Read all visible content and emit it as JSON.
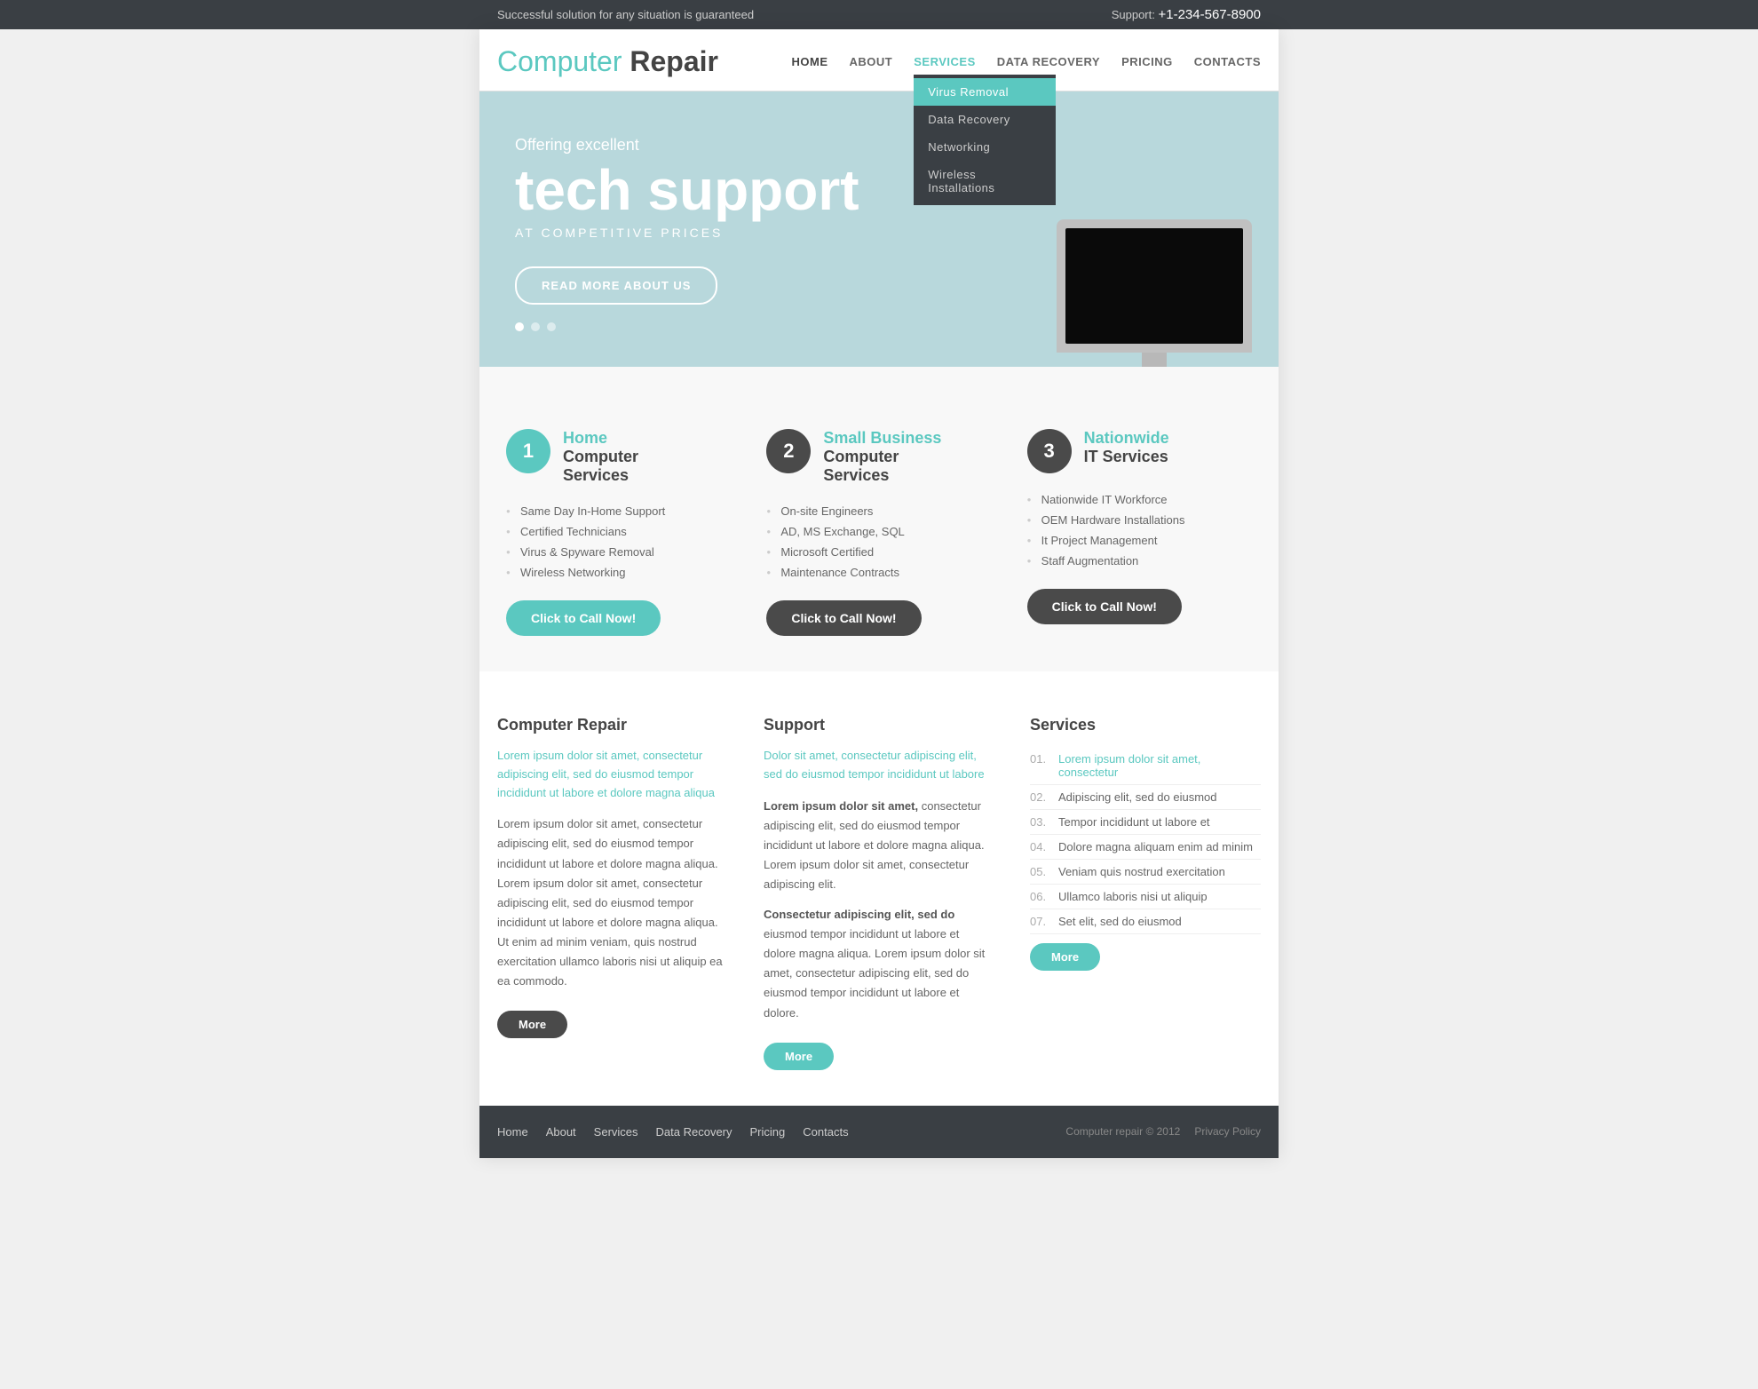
{
  "topbar": {
    "tagline": "Successful solution for any situation is guaranteed",
    "support_label": "Support:",
    "phone": "+1-234-567-8900"
  },
  "header": {
    "logo_teal": "Computer",
    "logo_dark": "Repair",
    "nav": {
      "items": [
        {
          "label": "HOME",
          "active": true
        },
        {
          "label": "ABOUT",
          "active": false
        },
        {
          "label": "SERVICES",
          "active": false,
          "has_dropdown": true
        },
        {
          "label": "DATA RECOVERY",
          "active": false
        },
        {
          "label": "PRICING",
          "active": false
        },
        {
          "label": "CONTACTS",
          "active": false
        }
      ],
      "dropdown": [
        {
          "label": "Virus Removal",
          "highlighted": true
        },
        {
          "label": "Data Recovery",
          "highlighted": false
        },
        {
          "label": "Networking",
          "highlighted": false
        },
        {
          "label": "Wireless Installations",
          "highlighted": false
        }
      ]
    }
  },
  "hero": {
    "sub": "Offering excellent",
    "title": "tech support",
    "subtitle": "AT COMPETITIVE PRICES",
    "button": "READ MORE ABOUT US"
  },
  "services": [
    {
      "num": "1",
      "color": "teal",
      "title_line1": "Home",
      "title_line2": "Computer Services",
      "items": [
        "Same Day In-Home Support",
        "Certified Technicians",
        "Virus & Spyware Removal",
        "Wireless Networking"
      ],
      "button": "Click to Call Now!"
    },
    {
      "num": "2",
      "color": "dark",
      "title_line1": "Small Business",
      "title_line2": "Computer Services",
      "items": [
        "On-site Engineers",
        "AD, MS Exchange, SQL",
        "Microsoft Certified",
        "Maintenance Contracts"
      ],
      "button": "Click to Call Now!"
    },
    {
      "num": "3",
      "color": "dark",
      "title_line1": "Nationwide",
      "title_line2": "IT Services",
      "items": [
        "Nationwide IT Workforce",
        "OEM Hardware Installations",
        "It Project Management",
        "Staff Augmentation"
      ],
      "button": "Click to Call Now!"
    }
  ],
  "content": {
    "col1": {
      "title": "Computer Repair",
      "teal_text": "Lorem ipsum dolor sit amet, consectetur adipiscing elit, sed do eiusmod tempor incididunt ut labore et dolore magna aliqua",
      "body": "Lorem ipsum dolor sit amet, consectetur adipiscing elit, sed do eiusmod tempor incididunt ut labore et dolore magna aliqua.  Lorem ipsum dolor sit amet, consectetur adipiscing elit, sed do eiusmod tempor incididunt ut labore et dolore magna aliqua.  Ut enim ad minim veniam, quis nostrud exercitation ullamco laboris nisi ut aliquip ea ea commodo.",
      "more": "More",
      "btn_style": "dark"
    },
    "col2": {
      "title": "Support",
      "teal_text": "Dolor sit amet, consectetur adipiscing elit, sed do eiusmod tempor incididunt ut labore",
      "body1_bold": "Lorem ipsum dolor sit amet,",
      "body1": " consectetur adipiscing elit, sed do eiusmod tempor incididunt ut labore et dolore magna aliqua.  Lorem ipsum dolor sit amet, consectetur adipiscing elit.",
      "body2_bold": "Consectetur adipiscing elit, sed do",
      "body2": " eiusmod tempor incididunt ut labore et dolore magna aliqua.  Lorem ipsum dolor sit amet, consectetur adipiscing elit, sed do eiusmod tempor incididunt ut labore et dolore.",
      "more": "More",
      "btn_style": "teal"
    },
    "col3": {
      "title": "Services",
      "more": "More",
      "btn_style": "teal",
      "items": [
        {
          "num": "01.",
          "text": "Lorem ipsum dolor sit amet, consectetur",
          "active": true
        },
        {
          "num": "02.",
          "text": "Adipiscing elit, sed do eiusmod",
          "active": false
        },
        {
          "num": "03.",
          "text": "Tempor incididunt ut labore et",
          "active": false
        },
        {
          "num": "04.",
          "text": "Dolore magna aliquam enim ad minim",
          "active": false
        },
        {
          "num": "05.",
          "text": "Veniam quis nostrud exercitation",
          "active": false
        },
        {
          "num": "06.",
          "text": "Ullamco laboris nisi ut aliquip",
          "active": false
        },
        {
          "num": "07.",
          "text": "Set elit, sed do eiusmod",
          "active": false
        }
      ]
    }
  },
  "footer": {
    "nav": [
      {
        "label": "Home"
      },
      {
        "label": "About"
      },
      {
        "label": "Services"
      },
      {
        "label": "Data Recovery"
      },
      {
        "label": "Pricing"
      },
      {
        "label": "Contacts"
      }
    ],
    "copy": "Computer repair © 2012",
    "privacy": "Privacy Policy"
  }
}
